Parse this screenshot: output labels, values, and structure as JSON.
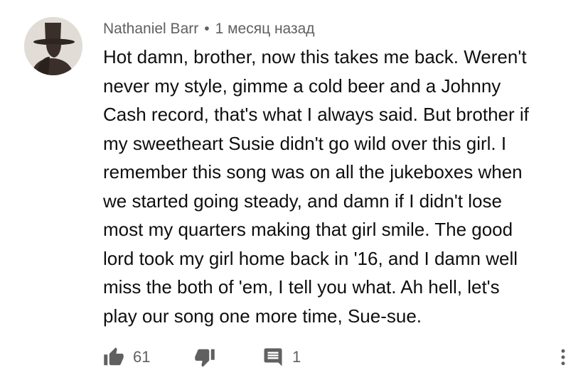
{
  "comment": {
    "author": "Nathaniel Barr",
    "separator": "•",
    "timestamp": "1 месяц назад",
    "text_lines": [
      "Hot damn, brother, now this takes me back. Weren't",
      "never my style, gimme a cold beer and a Johnny",
      "Cash record, that's what I always said. But brother if",
      "my sweetheart Susie didn't go wild over this girl. I",
      "remember this song was on all the jukeboxes when",
      "we started going steady, and damn if I didn't lose",
      "most my quarters making that girl smile. The good",
      "lord took my girl home back in '16, and I damn well",
      "miss the both of 'em, I tell you what. Ah hell, let's",
      "play our song one more time, Sue-sue."
    ],
    "actions": {
      "like_icon": "thumbs-up-icon",
      "like_count": "61",
      "dislike_icon": "thumbs-down-icon",
      "reply_icon": "reply-comment-icon",
      "reply_count": "1",
      "menu_icon": "more-vertical-icon"
    },
    "colors": {
      "text": "#0f0f0f",
      "meta": "#606060",
      "icon": "#606060"
    }
  }
}
